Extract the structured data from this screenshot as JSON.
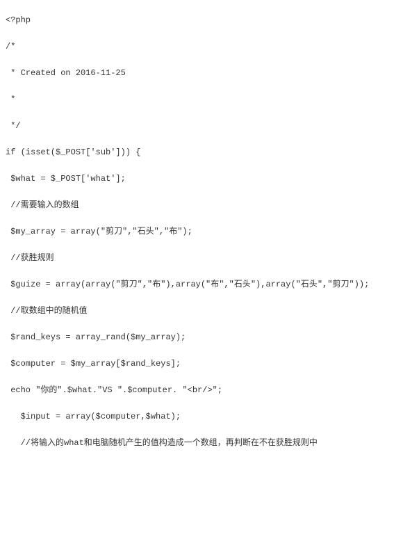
{
  "code": {
    "lines": [
      "<?php",
      "/*",
      " * Created on 2016-11-25",
      " *",
      " */",
      "if (isset($_POST['sub'])) {",
      " $what = $_POST['what'];",
      " //需要输入的数组",
      " $my_array = array(\"剪刀\",\"石头\",\"布\");",
      " //获胜规则",
      " $guize = array(array(\"剪刀\",\"布\"),array(\"布\",\"石头\"),array(\"石头\",\"剪刀\"));",
      " //取数组中的随机值",
      " $rand_keys = array_rand($my_array);",
      " $computer = $my_array[$rand_keys];",
      " echo \"你的\".$what.\"VS \".$computer. \"<br/>\";",
      "   $input = array($computer,$what);",
      "   //将输入的what和电脑随机产生的值构造成一个数组，再判断在不在获胜规则中"
    ]
  }
}
